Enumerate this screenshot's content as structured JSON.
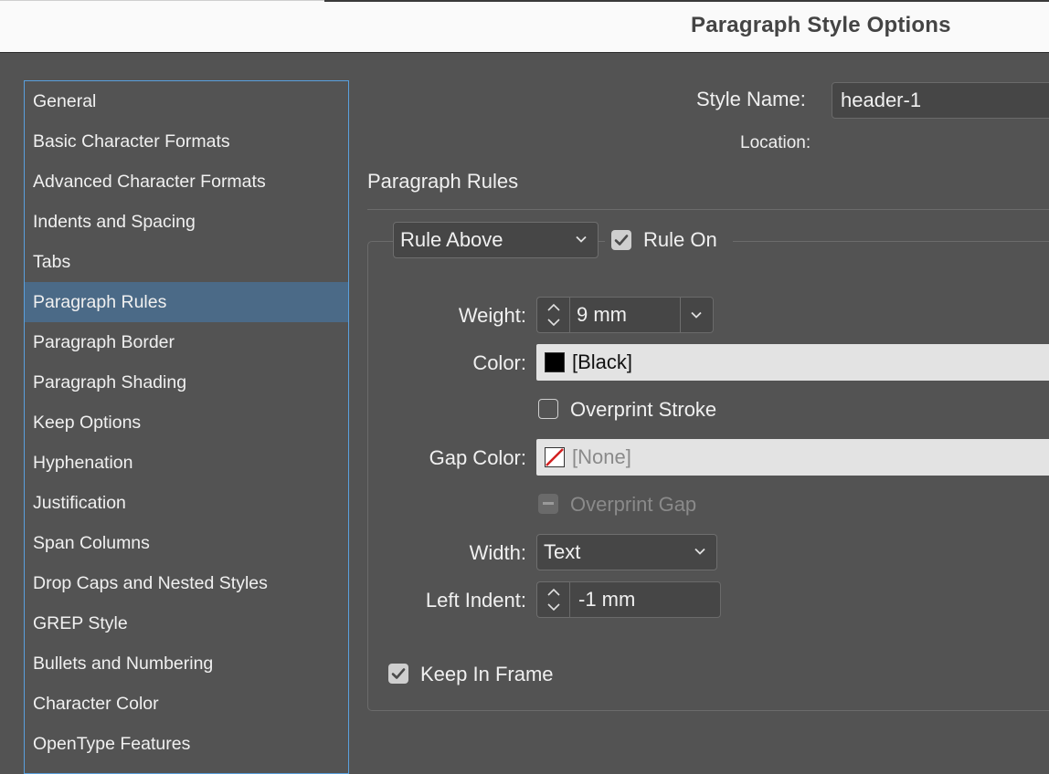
{
  "window": {
    "title": "Paragraph Style Options"
  },
  "sidebar": {
    "items": [
      {
        "label": "General"
      },
      {
        "label": "Basic Character Formats"
      },
      {
        "label": "Advanced Character Formats"
      },
      {
        "label": "Indents and Spacing"
      },
      {
        "label": "Tabs"
      },
      {
        "label": "Paragraph Rules"
      },
      {
        "label": "Paragraph Border"
      },
      {
        "label": "Paragraph Shading"
      },
      {
        "label": "Keep Options"
      },
      {
        "label": "Hyphenation"
      },
      {
        "label": "Justification"
      },
      {
        "label": "Span Columns"
      },
      {
        "label": "Drop Caps and Nested Styles"
      },
      {
        "label": "GREP Style"
      },
      {
        "label": "Bullets and Numbering"
      },
      {
        "label": "Character Color"
      },
      {
        "label": "OpenType Features"
      }
    ],
    "selected_index": 5
  },
  "header": {
    "style_name_label": "Style Name:",
    "style_name_value": "header-1",
    "location_label": "Location:"
  },
  "section": {
    "title": "Paragraph Rules"
  },
  "rule": {
    "type_value": "Rule Above",
    "rule_on_label": "Rule On",
    "rule_on_checked": true
  },
  "fields": {
    "weight_label": "Weight:",
    "weight_value": "9 mm",
    "color_label": "Color:",
    "color_value": "[Black]",
    "overprint_stroke_label": "Overprint Stroke",
    "overprint_stroke_checked": false,
    "gap_color_label": "Gap Color:",
    "gap_color_value": "[None]",
    "overprint_gap_label": "Overprint Gap",
    "overprint_gap_state": "disabled",
    "width_label": "Width:",
    "width_value": "Text",
    "left_indent_label": "Left Indent:",
    "left_indent_value": "-1 mm",
    "keep_in_frame_label": "Keep In Frame",
    "keep_in_frame_checked": true
  },
  "colors": {
    "selection": "#4b6a87",
    "focus_border": "#5aa0dd",
    "dialog_bg": "#535353",
    "swatch_black": "#000000",
    "none_slash": "#d22020"
  },
  "icons": [
    "chevron-down-icon",
    "stepper-arrows-icon",
    "checkmark-icon",
    "none-swatch-icon"
  ]
}
